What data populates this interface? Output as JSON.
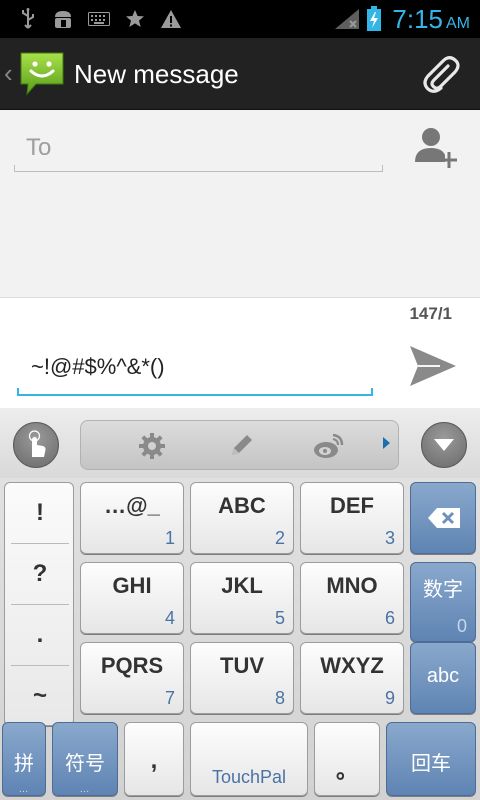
{
  "status_bar": {
    "time": "7:15",
    "ampm": "AM",
    "icons": [
      "usb-icon",
      "android-debug-icon",
      "keyboard-icon",
      "star-icon",
      "warning-icon",
      "no-signal-icon",
      "battery-charging-icon"
    ]
  },
  "action_bar": {
    "title": "New message",
    "back_icon": "chevron-left-icon",
    "app_icon": "messaging-smiley-icon",
    "attach_icon": "paperclip-icon"
  },
  "recipients": {
    "to_placeholder": "To",
    "add_contact_icon": "add-contact-icon"
  },
  "compose": {
    "counter": "147/1",
    "message_text": "~!@#$%^&*()",
    "send_icon": "send-icon"
  },
  "keyboard": {
    "toolbar": {
      "left_icon": "handwriting-hand-icon",
      "strip_icons": [
        "settings-gear-icon",
        "pencil-icon",
        "weibo-icon"
      ],
      "hide_icon": "chevron-down-icon"
    },
    "symbols": [
      "!",
      "?",
      ".",
      "~"
    ],
    "keys": [
      {
        "main": "…@_",
        "num": "1"
      },
      {
        "main": "ABC",
        "num": "2"
      },
      {
        "main": "DEF",
        "num": "3"
      },
      {
        "main": "GHI",
        "num": "4"
      },
      {
        "main": "JKL",
        "num": "5"
      },
      {
        "main": "MNO",
        "num": "6"
      },
      {
        "main": "PQRS",
        "num": "7"
      },
      {
        "main": "TUV",
        "num": "8"
      },
      {
        "main": "WXYZ",
        "num": "9"
      }
    ],
    "side_keys": {
      "backspace_icon": "backspace-icon",
      "numbers": {
        "main": "数字",
        "num": "0"
      },
      "abc": "abc"
    },
    "bottom_row": {
      "pinyin": "拼",
      "symbols": "符号",
      "comma": ",",
      "space": "TouchPal",
      "period": "。",
      "enter": "回车",
      "more": "…"
    }
  },
  "colors": {
    "accent": "#33b5e5",
    "key_blue": "#6f91bd",
    "number_label": "#4a73a5"
  }
}
